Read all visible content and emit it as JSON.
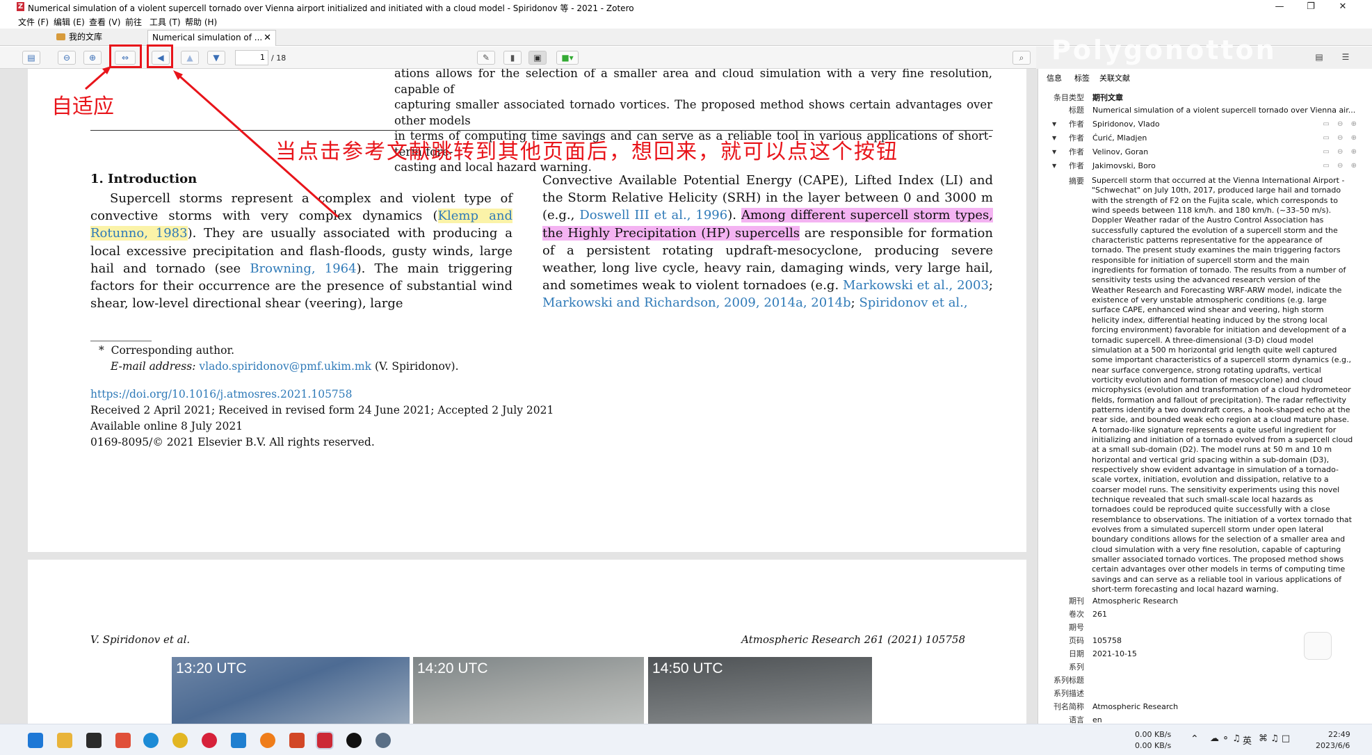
{
  "window": {
    "title": "Numerical simulation of a violent supercell tornado over Vienna airport initialized and initiated with a cloud model - Spiridonov 等 - 2021 - Zotero",
    "app_icon": "Z"
  },
  "menu": [
    "文件 (F)",
    "编辑 (E)",
    "查看 (V)",
    "前往",
    "工具 (T)",
    "帮助 (H)"
  ],
  "tabs": {
    "library": "我的文库",
    "document": "Numerical simulation of ..."
  },
  "toolbar": {
    "page_current": "1",
    "page_total": "/ 18"
  },
  "annotations": {
    "fit": "自适应",
    "back": "当点击参考文献跳转到其他页面后，想回来，就可以点这个按钮"
  },
  "pdf": {
    "abstract_tail": [
      "ations allows for the selection of a smaller area and cloud simulation with a very fine resolution, capable of",
      "capturing smaller associated tornado vortices. The proposed method shows certain advantages over other models",
      "in terms of computing time savings and can serve as a reliable tool in various applications of short-term fore-",
      "casting and local hazard warning."
    ],
    "heading": "1.  Introduction",
    "left": {
      "t1": "Supercell storms represent a complex and violent type of convective storms with very complex dynamics (",
      "l1": "Klemp and Rotunno, 1983",
      "t2": "). They are usually associated with producing a local excessive precipitation and flash-floods, gusty winds, large hail and tornado (see ",
      "l2": "Browning, 1964",
      "t3": "). The main triggering factors for their occurrence are the presence of substantial wind shear, low-level directional shear (veering), large"
    },
    "right": {
      "t1": "Convective Available Potential Energy (CAPE), Lifted Index (LI) and the Storm Relative Helicity (SRH) in the layer between 0 and 3000 m (e.g., ",
      "l1": "Doswell III et al., 1996",
      "t2": "). ",
      "h1": "Among different supercell storm types, the Highly Precipitation (HP) supercells",
      "t3": " are responsible for formation of a persistent rotating updraft-mesocyclone, producing severe weather, long live cycle, heavy rain, damaging winds, very large hail, and sometimes weak to violent tornadoes (e.g. ",
      "l2": "Markowski et al., 2003",
      "t4": "; ",
      "l3": "Markowski and Richardson, 2009, 2014a, 2014b",
      "t5": "; ",
      "l4": "Spiridonov et al.,"
    },
    "footnote": {
      "mark": "*",
      "text": "Corresponding author.",
      "email_label": "E-mail address:",
      "email": "vlado.spiridonov@pmf.ukim.mk",
      "email_name": "(V. Spiridonov)."
    },
    "doi": "https://doi.org/10.1016/j.atmosres.2021.105758",
    "received": "Received 2 April 2021; Received in revised form 24 June 2021; Accepted 2 July 2021",
    "online": "Available online 8 July 2021",
    "copyright": "0169-8095/© 2021 Elsevier B.V. All rights reserved.",
    "page2": {
      "author": "V. Spiridonov et al.",
      "journal": "Atmospheric Research 261 (2021) 105758",
      "photos": [
        "13:20 UTC",
        "14:20 UTC",
        "14:50 UTC"
      ]
    }
  },
  "sidebar": {
    "tabs": [
      "信息",
      "标签",
      "关联文献"
    ],
    "item_type_label": "条目类型",
    "item_type": "期刊文章",
    "title_label": "标题",
    "title": "Numerical simulation of a violent supercell tornado over Vienna air...",
    "author_label": "作者",
    "authors": [
      "Spiridonov, Vlado",
      "Ćurić, Mladjen",
      "Velinov, Goran",
      "Jakimovski, Boro"
    ],
    "abstract_label": "摘要",
    "abstract": "Supercell storm that occurred at the Vienna International Airport - \"Schwechat\" on July 10th, 2017, produced large hail and tornado with the strength of F2 on the Fujita scale, which corresponds to wind speeds between 118 km/h. and 180 km/h. (~33–50 m/s). Doppler Weather radar of the Austro Control Association has successfully captured the evolution of a supercell storm and the characteristic patterns representative for the appearance of tornado. The present study examines the main triggering factors responsible for initiation of supercell storm and the main ingredients for formation of tornado. The results from a number of sensitivity tests using the advanced research version of the Weather Research and Forecasting WRF-ARW model, indicate the existence of very unstable atmospheric conditions (e.g. large surface CAPE, enhanced wind shear and veering, high storm helicity index, differential heating induced by the strong local forcing environment) favorable for initiation and development of a tornadic supercell. A three-dimensional (3-D) cloud model simulation at a 500 m horizontal grid length quite well captured some important characteristics of a supercell storm dynamics (e.g., near surface convergence, strong rotating updrafts, vertical vorticity evolution and formation of mesocyclone) and cloud microphysics (evolution and transformation of a cloud hydrometeor fields, formation and fallout of precipitation). The radar reflectivity patterns identify a two downdraft cores, a hook-shaped echo at the rear side, and bounded weak echo region at a cloud mature phase. A tornado-like signature represents a quite useful ingredient for initializing and initiation of a tornado evolved from a supercell cloud at a small sub-domain (D2). The model runs at 50 m and 10 m horizontal and vertical grid spacing within a sub-domain (D3), respectively show evident advantage in simulation of a tornado-scale vortex, initiation, evolution and dissipation, relative to a coarser model runs. The sensitivity experiments using this novel technique revealed that such small-scale local hazards as tornadoes could be reproduced quite successfully with a close resemblance to observations. The initiation of a vortex tornado that evolves from a simulated supercell storm under open lateral boundary conditions allows for the selection of a smaller area and cloud simulation with a very fine resolution, capable of capturing smaller associated tornado vortices. The proposed method shows certain advantages over other models in terms of computing time savings and can serve as a reliable tool in various applications of short-term forecasting and local hazard warning.",
    "fields": [
      {
        "label": "期刊",
        "value": "Atmospheric Research"
      },
      {
        "label": "卷次",
        "value": "261"
      },
      {
        "label": "期号",
        "value": ""
      },
      {
        "label": "页码",
        "value": "105758"
      },
      {
        "label": "日期",
        "value": "2021-10-15"
      },
      {
        "label": "系列",
        "value": ""
      },
      {
        "label": "系列标题",
        "value": ""
      },
      {
        "label": "系列描述",
        "value": ""
      },
      {
        "label": "刊名简称",
        "value": "Atmospheric Research"
      },
      {
        "label": "语言",
        "value": "en"
      }
    ],
    "watermark": "Polygonotton"
  },
  "taskbar": {
    "net_up": "0.00 KB/s",
    "net_down": "0.00 KB/s",
    "ime": "英",
    "time": "22:49",
    "date": "2023/6/6"
  }
}
